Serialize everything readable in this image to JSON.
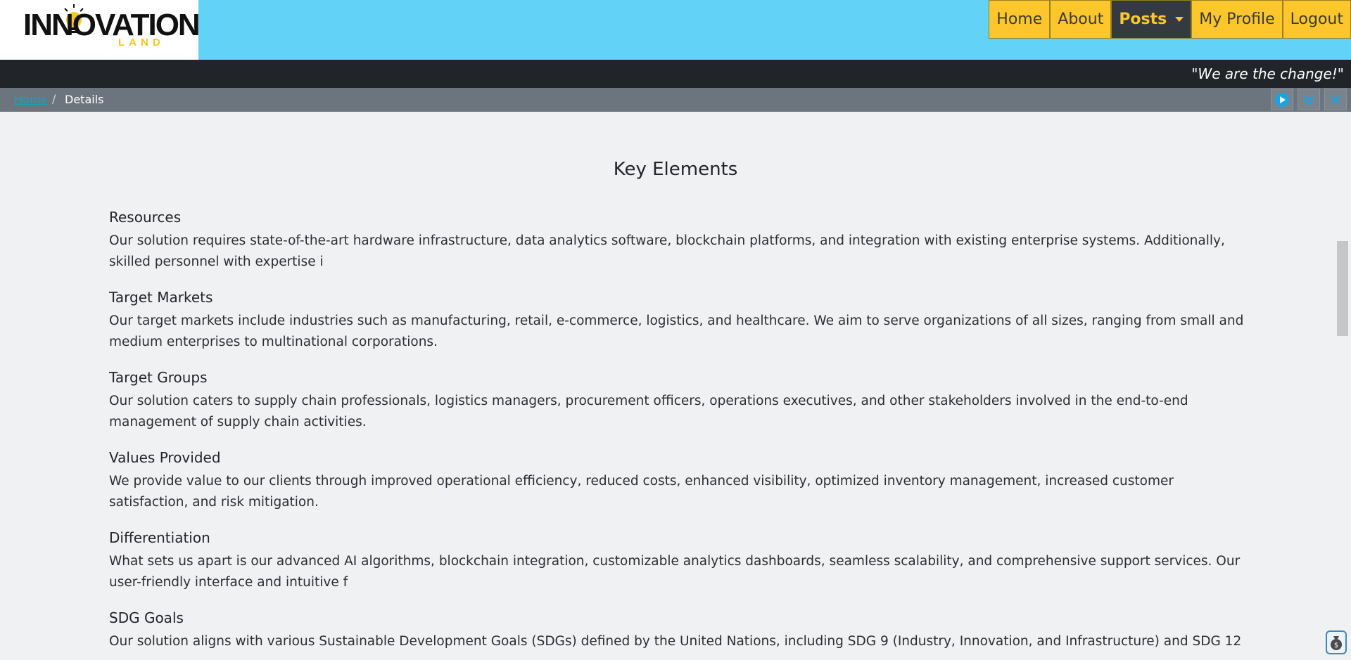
{
  "brand": {
    "logo_main": "INNOVATION",
    "logo_sub": "LAND"
  },
  "nav": {
    "items": [
      {
        "label": "Home"
      },
      {
        "label": "About"
      },
      {
        "label": "Posts",
        "active": true
      },
      {
        "label": "My Profile"
      },
      {
        "label": "Logout"
      }
    ]
  },
  "tagline": "\"We are the change!\"",
  "breadcrumb": {
    "home": "Home",
    "separator": "/",
    "current": "Details"
  },
  "toolbar_icons": [
    "play-icon",
    "double-chevron-down-icon",
    "close-icon"
  ],
  "main": {
    "title": "Key Elements",
    "sections": [
      {
        "title": "Resources",
        "body": "Our solution requires state-of-the-art hardware infrastructure, data analytics software, blockchain platforms, and integration with existing enterprise systems. Additionally, skilled personnel with expertise i"
      },
      {
        "title": "Target Markets",
        "body": "Our target markets include industries such as manufacturing, retail, e-commerce, logistics, and healthcare. We aim to serve organizations of all sizes, ranging from small and medium enterprises to multinational corporations."
      },
      {
        "title": "Target Groups",
        "body": "Our solution caters to supply chain professionals, logistics managers, procurement officers, operations executives, and other stakeholders involved in the end-to-end management of supply chain activities."
      },
      {
        "title": "Values Provided",
        "body": "We provide value to our clients through improved operational efficiency, reduced costs, enhanced visibility, optimized inventory management, increased customer satisfaction, and risk mitigation."
      },
      {
        "title": "Differentiation",
        "body": "What sets us apart is our advanced AI algorithms, blockchain integration, customizable analytics dashboards, seamless scalability, and comprehensive support services. Our user-friendly interface and intuitive f"
      },
      {
        "title": "SDG Goals",
        "body": "Our solution aligns with various Sustainable Development Goals (SDGs) defined by the United Nations, including SDG 9 (Industry, Innovation, and Infrastructure) and SDG 12"
      }
    ]
  },
  "colors": {
    "topbar": "#62d2f7",
    "nav_item": "#fcc62c",
    "nav_active": "#343a40",
    "tagline_bar": "#212529",
    "breadcrumb_bar": "#6c757d",
    "page_bg": "#f0f1f3"
  }
}
